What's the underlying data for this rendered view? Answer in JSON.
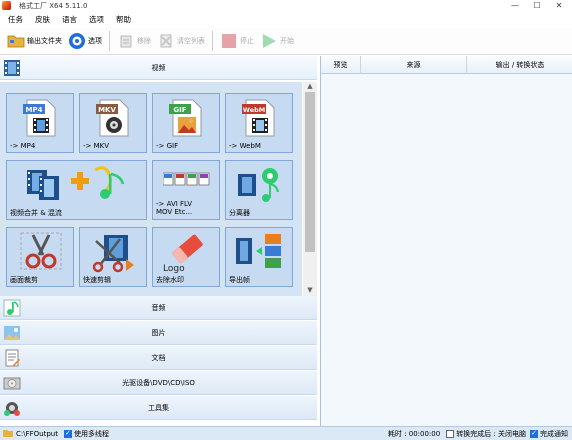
{
  "window": {
    "title": "格式工厂 X64 5.11.0",
    "minimize": "—",
    "maximize": "☐",
    "close": "✕"
  },
  "menu": [
    "任务",
    "皮肤",
    "语言",
    "选项",
    "帮助"
  ],
  "toolbar": {
    "output_folder": "输出文件夹",
    "options": "选项",
    "remove": "移除",
    "clear_list": "清空列表",
    "stop": "停止",
    "start": "开始"
  },
  "categories": {
    "video": "视频",
    "audio": "音频",
    "image": "图片",
    "document": "文档",
    "disc": "光驱设备\\DVD\\CD\\ISO",
    "tools": "工具集"
  },
  "tiles": [
    {
      "label": "-> MP4",
      "badge": "MP4",
      "badge_color": "#3a7bd5"
    },
    {
      "label": "-> MKV",
      "badge": "MKV",
      "badge_color": "#8a5a3c"
    },
    {
      "label": "-> GIF",
      "badge": "GIF",
      "badge_color": "#3ea04a"
    },
    {
      "label": "-> WebM",
      "badge": "WebM",
      "badge_color": "#c0392b"
    },
    {
      "label": "视频合并 & 混流"
    },
    {
      "label": "-> AVI FLV\nMOV Etc..."
    },
    {
      "label": "分离器"
    },
    {
      "label": "画面裁剪"
    },
    {
      "label": "快速剪辑"
    },
    {
      "label": "去除水印",
      "logo_text": "Logo"
    },
    {
      "label": "导出帧"
    }
  ],
  "right_panel": {
    "columns": [
      "预览",
      "来源",
      "输出 / 转换状态"
    ]
  },
  "status": {
    "output_path": "C:\\FFOutput",
    "multithread": "使用多线程",
    "elapsed": "耗时 : 00:00:00",
    "after_convert": "转换完成后 : 关闭电脑",
    "notify": "完成通知"
  },
  "colors": {
    "accent": "#1e6fd9",
    "tile_bg": "#c6daf2",
    "tile_border": "#7fa8d8"
  }
}
